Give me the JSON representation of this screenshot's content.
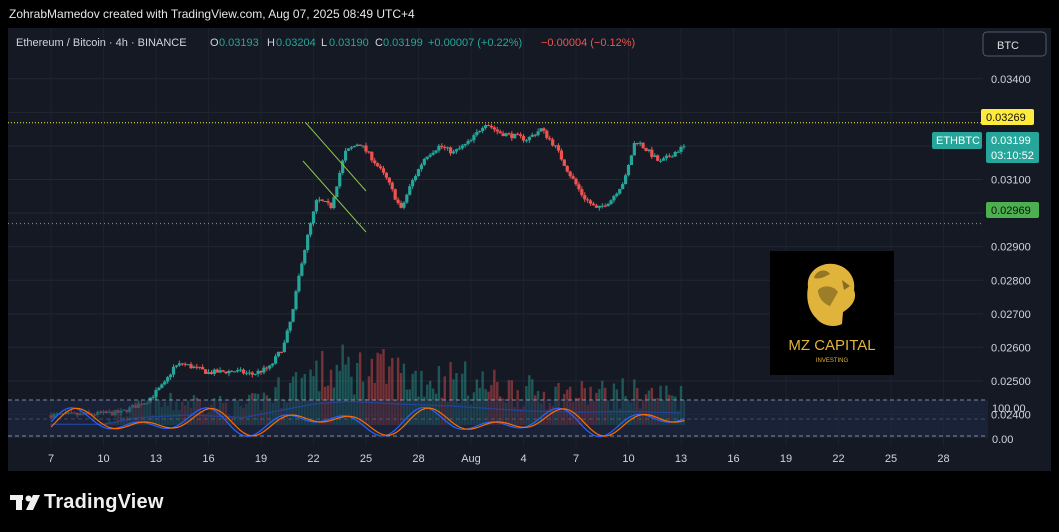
{
  "header": {
    "attribution": "ZohrabMamedov created with TradingView.com, Aug 07, 2025 08:49 UTC+4"
  },
  "legend": {
    "symbol": "Ethereum / Bitcoin · 4h · BINANCE",
    "o_label": "O",
    "o": "0.03193",
    "h_label": "H",
    "h": "0.03204",
    "l_label": "L",
    "l": "0.03190",
    "c_label": "C",
    "c": "0.03199",
    "change": "+0.00007 (+0.22%)",
    "change2": "−0.00004 (−0.12%)"
  },
  "currency_button": "BTC",
  "footer": {
    "brand": "TradingView"
  },
  "watermark": {
    "title": "MZ CAPITAL",
    "subtitle": "INVESTING"
  },
  "price_labels": {
    "upper_line": "0.03269",
    "lower_line": "0.02969",
    "symbol_tag": "ETHBTC",
    "last_price": "0.03199",
    "countdown": "03:10:52"
  },
  "colors": {
    "up": "#26a69a",
    "down": "#ef5350",
    "background": "#151924",
    "upper_line": "#ffeb3b",
    "lower_line": "#4caf50",
    "volume_ma": "#2962ff"
  },
  "chart_data": {
    "type": "candlestick",
    "interval": "4h",
    "y_axis_ticks": [
      "0.03400",
      "0.03300",
      "0.03200",
      "0.03100",
      "0.03000",
      "0.02900",
      "0.02800",
      "0.02700",
      "0.02600",
      "0.02500",
      "0.02400"
    ],
    "ylim": [
      0.0236,
      0.0345
    ],
    "x_axis_ticks": [
      "7",
      "10",
      "13",
      "16",
      "19",
      "22",
      "25",
      "28",
      "Aug",
      "4",
      "7",
      "10",
      "13",
      "16",
      "19",
      "22",
      "25",
      "28"
    ],
    "horizontal_levels": [
      0.03269,
      0.02969
    ],
    "price_path": [
      [
        0,
        0.02398
      ],
      [
        2,
        0.024
      ],
      [
        4,
        0.02406
      ],
      [
        5.5,
        0.02442
      ],
      [
        6.5,
        0.02492
      ],
      [
        7,
        0.0254
      ],
      [
        7.5,
        0.02552
      ],
      [
        9,
        0.02525
      ],
      [
        10.5,
        0.0253
      ],
      [
        11.5,
        0.0252
      ],
      [
        12.5,
        0.0254
      ],
      [
        13.3,
        0.02605
      ],
      [
        13.8,
        0.027
      ],
      [
        14.3,
        0.0285
      ],
      [
        14.8,
        0.0296
      ],
      [
        15.2,
        0.0304
      ],
      [
        16,
        0.0302
      ],
      [
        16.8,
        0.0318
      ],
      [
        17.6,
        0.0321
      ],
      [
        18.4,
        0.0316
      ],
      [
        19.2,
        0.031
      ],
      [
        20,
        0.0301
      ],
      [
        20.6,
        0.0309
      ],
      [
        21.4,
        0.0317
      ],
      [
        22.2,
        0.032
      ],
      [
        23,
        0.0318
      ],
      [
        24,
        0.03215
      ],
      [
        24.8,
        0.0327
      ],
      [
        25.6,
        0.0324
      ],
      [
        26.4,
        0.0323
      ],
      [
        27.2,
        0.0322
      ],
      [
        28,
        0.0325
      ],
      [
        28.8,
        0.032
      ],
      [
        29.6,
        0.0312
      ],
      [
        30.4,
        0.0305
      ],
      [
        31.2,
        0.0301
      ],
      [
        32,
        0.0304
      ],
      [
        32.8,
        0.031
      ],
      [
        33.4,
        0.0322
      ],
      [
        34,
        0.0319
      ],
      [
        34.8,
        0.0315
      ],
      [
        35.6,
        0.0318
      ],
      [
        36.2,
        0.03199
      ]
    ],
    "volume_ma_path": [
      [
        0,
        0.018
      ],
      [
        3,
        0.018
      ],
      [
        5,
        0.22
      ],
      [
        8,
        0.3
      ],
      [
        11,
        0.22
      ],
      [
        13,
        0.42
      ],
      [
        15,
        0.62
      ],
      [
        17,
        0.7
      ],
      [
        20,
        0.62
      ],
      [
        23,
        0.56
      ],
      [
        27,
        0.42
      ],
      [
        30,
        0.38
      ],
      [
        33,
        0.4
      ],
      [
        36,
        0.36
      ]
    ],
    "stoch_rsi_ticks": [
      "100.00",
      "0.00"
    ]
  }
}
